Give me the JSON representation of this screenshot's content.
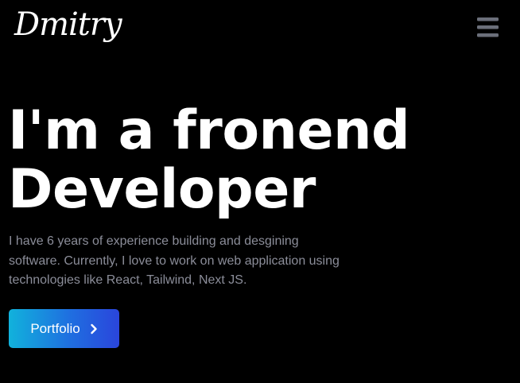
{
  "navbar": {
    "logo_text": "Dmitry",
    "menu_icon": "hamburger-menu-icon",
    "menu_icon_color": "#6b6f7a"
  },
  "hero": {
    "title_line1": "I'm a fronend",
    "title_line2": "Developer",
    "description_lines": [
      "I have 6 years of experience building and desgining",
      "software. Currently, I love to work on web application using",
      "technologies like React, Tailwind, Next JS."
    ],
    "cta": {
      "label": "Portfolio",
      "icon": "chevron-right-icon",
      "gradient_start": "#11b2dc",
      "gradient_end": "#2a45dc"
    }
  },
  "colors": {
    "background": "#000000",
    "text_primary": "#ffffff",
    "text_secondary": "#8b8d99"
  }
}
